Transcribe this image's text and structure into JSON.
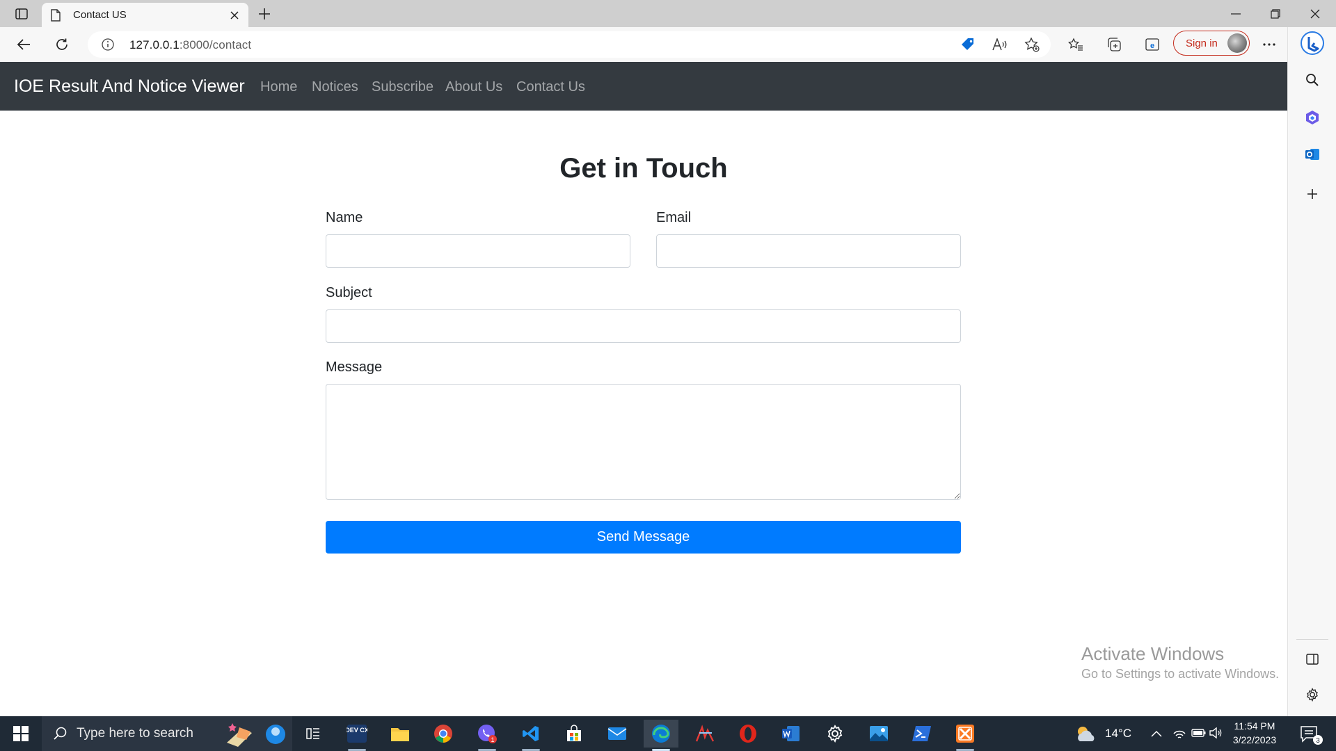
{
  "browser": {
    "tab_title": "Contact US",
    "url_host": "127.0.0.1",
    "url_path": ":8000/contact",
    "signin_label": "Sign in"
  },
  "site": {
    "brand": "IOE Result And Notice Viewer",
    "nav": [
      "Home",
      "Notices",
      "Subscribe",
      "About Us",
      "Contact Us"
    ]
  },
  "form": {
    "heading": "Get in Touch",
    "name_label": "Name",
    "email_label": "Email",
    "subject_label": "Subject",
    "message_label": "Message",
    "name_value": "",
    "email_value": "",
    "subject_value": "",
    "message_value": "",
    "submit_label": "Send Message"
  },
  "watermark": {
    "title": "Activate Windows",
    "subtitle": "Go to Settings to activate Windows."
  },
  "taskbar": {
    "search_placeholder": "Type here to search",
    "temperature": "14°C",
    "time": "11:54 PM",
    "date": "3/22/2023",
    "notification_count": "3",
    "viber_badge": "1",
    "devcx_label": "DEV CX"
  },
  "colors": {
    "navbar": "#343a40",
    "primary_button": "#007bff",
    "signin_accent": "#c42b1c",
    "taskbar": "#1f2a36"
  }
}
